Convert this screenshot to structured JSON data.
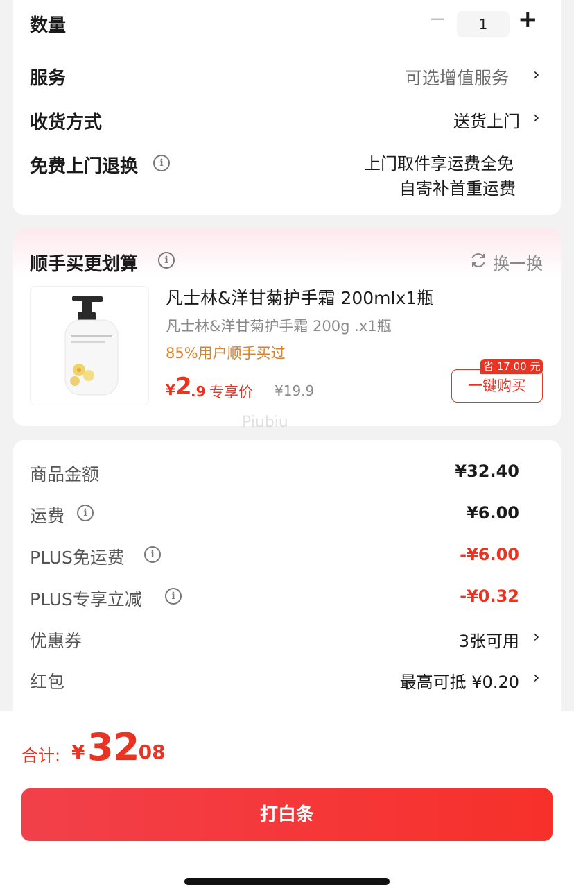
{
  "order": {
    "quantity_label": "数量",
    "quantity_minus": "−",
    "quantity_value": "1",
    "quantity_plus": "+",
    "service_label": "服务",
    "service_value": "可选增值服务",
    "delivery_label": "收货方式",
    "delivery_value": "送货上门",
    "return_label": "免费上门退换",
    "return_line1": "上门取件享运费全免",
    "return_line2": "自寄补首重运费"
  },
  "addon": {
    "title": "顺手买更划算",
    "refresh_label": "换一换",
    "product_name": "凡士林&洋甘菊护手霜 200mlx1瓶",
    "product_spec": "凡士林&洋甘菊护手霜 200g .x1瓶",
    "bought_ratio": "85%用户顺手买过",
    "price_symbol": "¥",
    "price_int": "2",
    "price_dec": ".9",
    "price_tag": "专享价",
    "orig_price": "¥19.9",
    "save_badge": "省 17.00 元",
    "buy_button": "一键购买",
    "watermark": "Piubiu"
  },
  "summary": {
    "rows": [
      {
        "label": "商品金额",
        "value": "¥32.40"
      },
      {
        "label": "运费",
        "value": "¥6.00"
      },
      {
        "label": "PLUS免运费",
        "value": "-¥6.00"
      },
      {
        "label": "PLUS专享立减",
        "value": "-¥0.32"
      },
      {
        "label": "优惠券",
        "value": "3张可用"
      },
      {
        "label": "红包",
        "value": "最高可抵 ¥0.20"
      }
    ]
  },
  "footer": {
    "total_label": "合计:",
    "total_symbol": "¥",
    "total_int": "32",
    "total_dec": ".08",
    "pay_button": "打白条"
  },
  "colors": {
    "accent": "#e93323",
    "bought_orange": "#d9822b",
    "background": "#f2f2f2"
  }
}
